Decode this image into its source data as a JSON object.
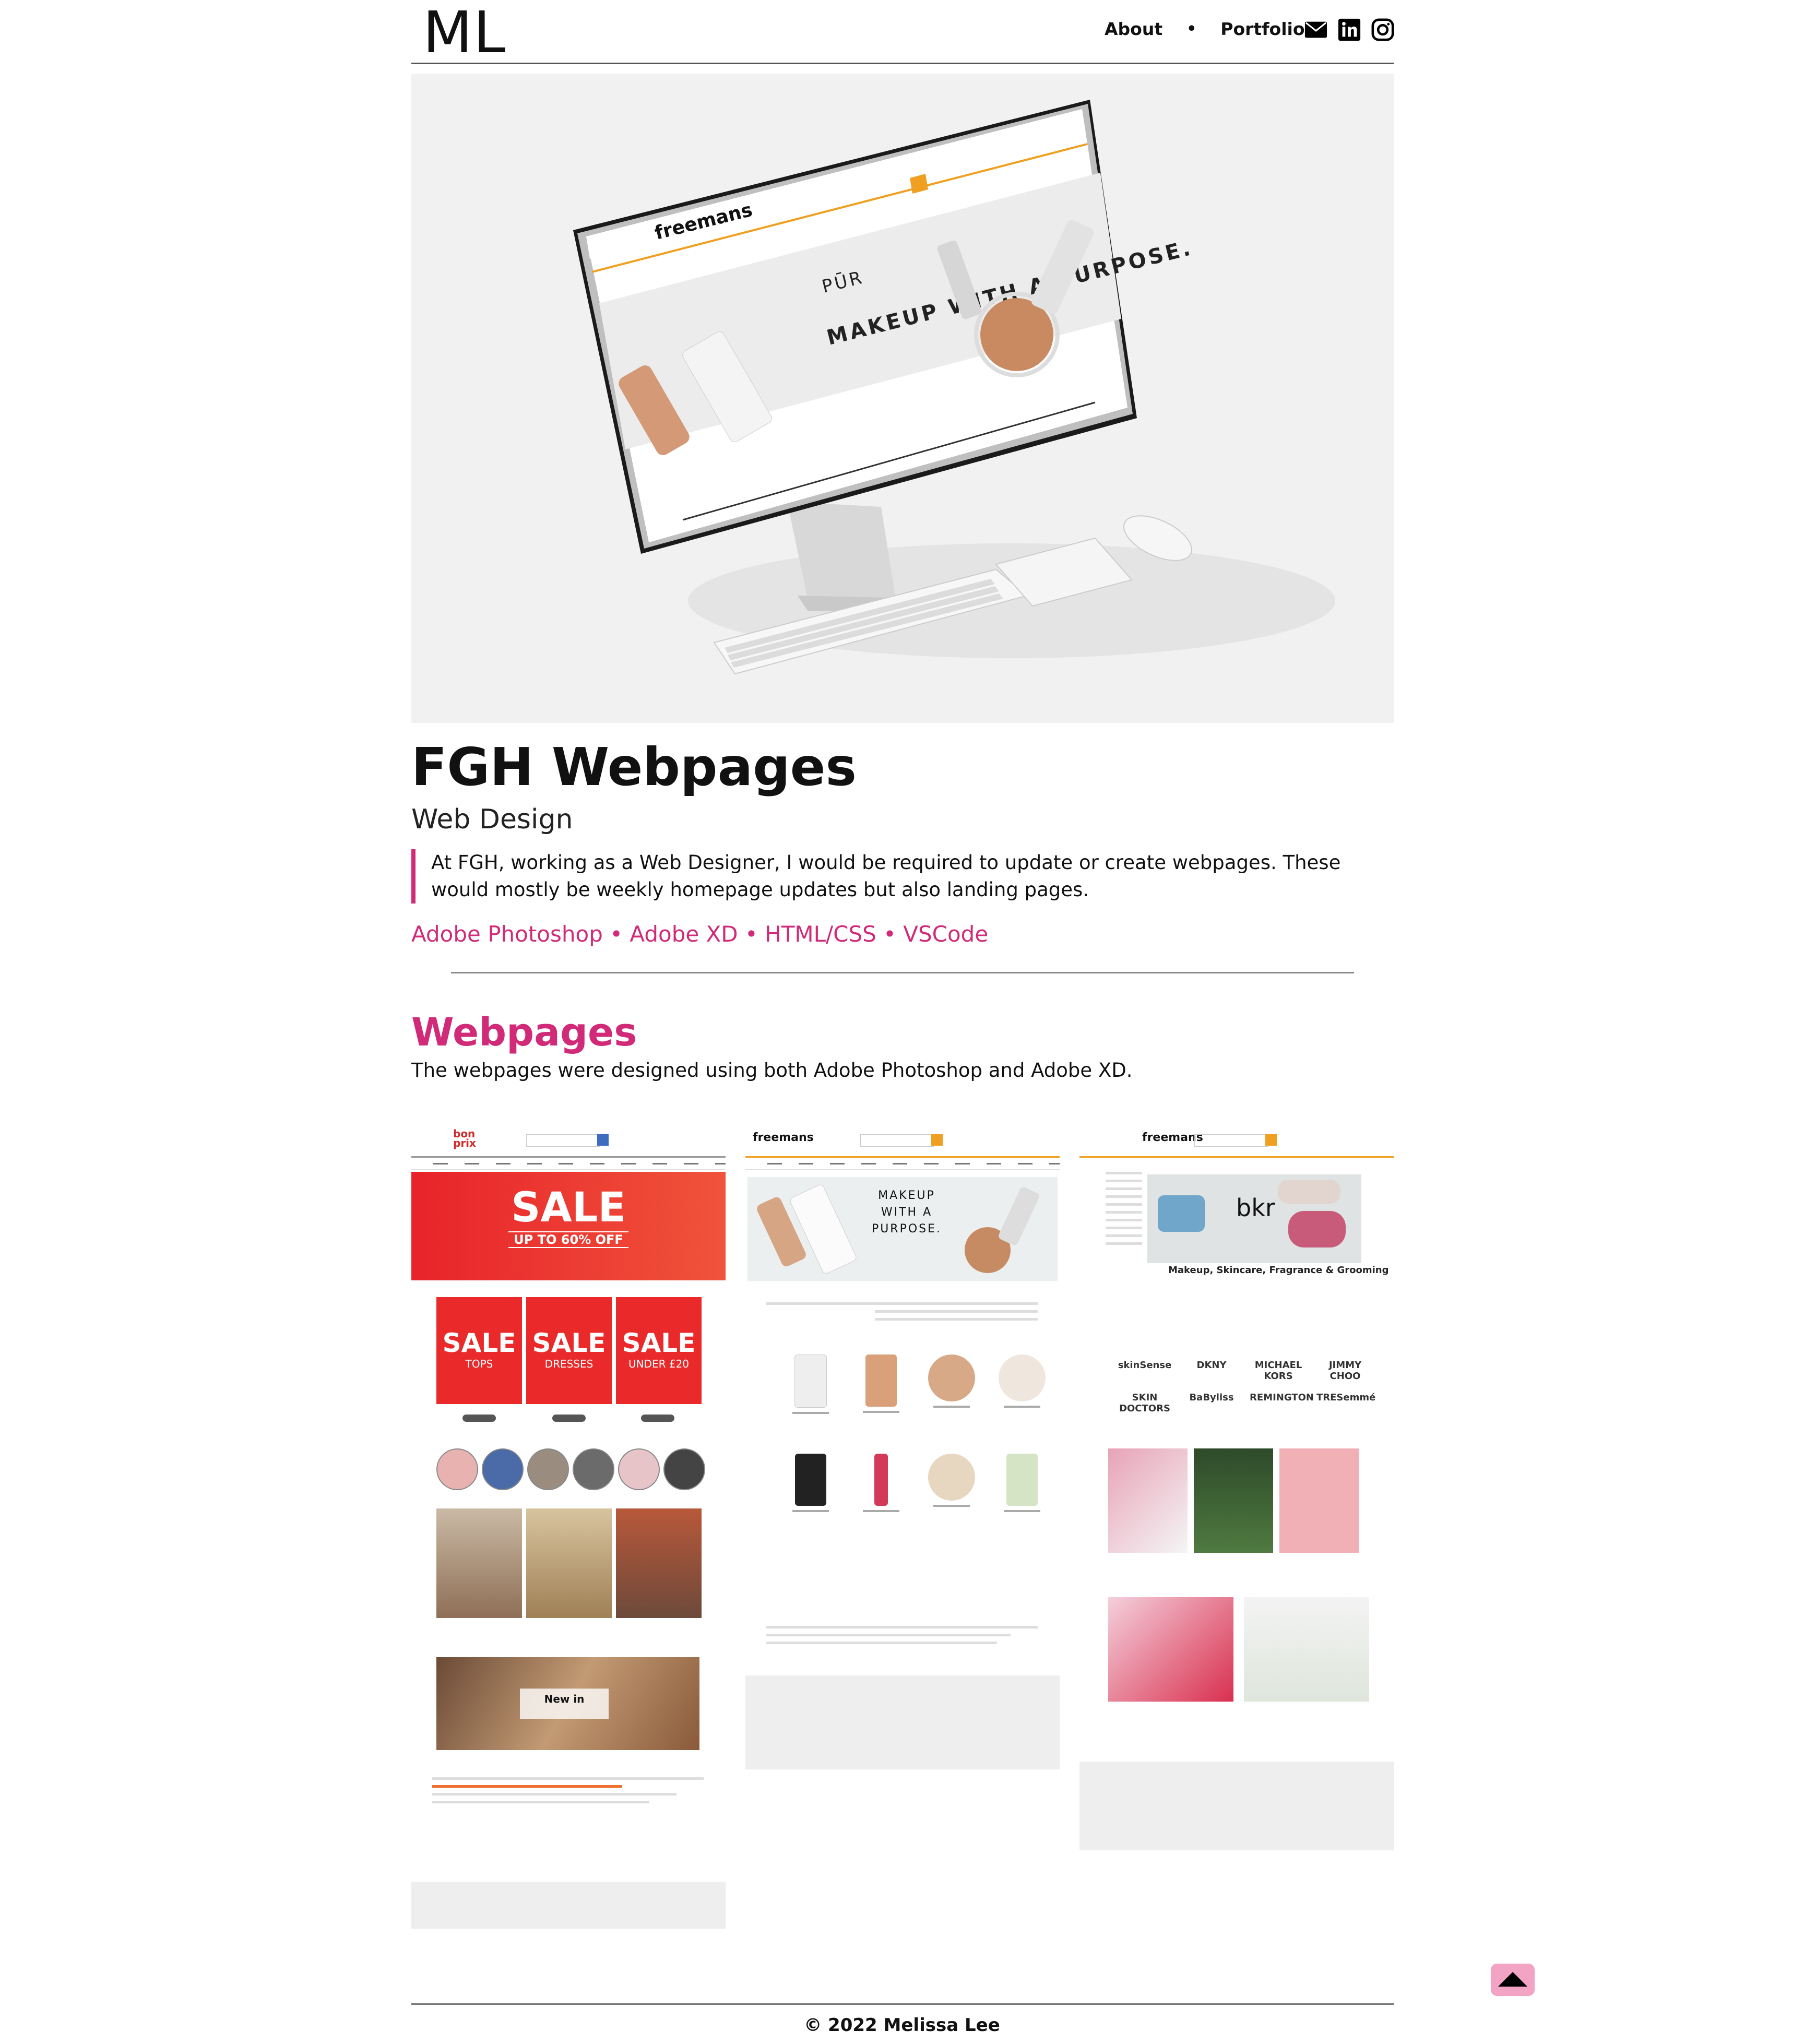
{
  "nav": {
    "logo": "ML",
    "links": [
      "About",
      "Portfolio"
    ],
    "separator": "•",
    "social_icons": [
      "envelope-icon",
      "linkedin-icon",
      "instagram-icon"
    ]
  },
  "hero": {
    "image": "imac-mockup-freemans-pur-makeup",
    "screen_brand": "freemans",
    "screen_headline": "MAKEUP WITH A PURPOSE.",
    "screen_brand2": "PŪR"
  },
  "project": {
    "title": "FGH Webpages",
    "subtitle": "Web Design",
    "description": "At FGH, working as a Web Designer, I would be required to update or create webpages. These would mostly be weekly homepage updates but also landing pages.",
    "tools": "Adobe Photoshop • Adobe XD • HTML/CSS  • VSCode"
  },
  "webpages": {
    "title": "Webpages",
    "description": "The webpages were designed using both Adobe Photoshop and Adobe XD.",
    "thumbs": [
      {
        "brand": "bon prix",
        "banner_title": "SALE",
        "banner_sub": "UP TO 60% OFF",
        "sale_tiles": [
          {
            "big": "SALE",
            "small": "TOPS"
          },
          {
            "big": "SALE",
            "small": "DRESSES"
          },
          {
            "big": "SALE",
            "small": "UNDER £20"
          }
        ],
        "feature": "New in"
      },
      {
        "brand": "freemans",
        "banner_text": "MAKEUP WITH A PURPOSE."
      },
      {
        "brand": "freemans",
        "banner_brand": "bkr",
        "heading": "Makeup, Skincare, Fragrance & Grooming",
        "brands": [
          "skinSense",
          "DKNY",
          "MICHAEL KORS",
          "JIMMY CHOO",
          "SKIN DOCTORS",
          "BaByliss",
          "REMINGTON",
          "TRESemmé"
        ]
      }
    ]
  },
  "colors": {
    "accent": "#d12a78",
    "sale_red": "#ea2a2a",
    "freemans_orange": "#f0a020",
    "top_button": "#f3a3c3"
  },
  "footer": {
    "copyright": "© 2022 Melissa Lee",
    "back_to_top_icon": "caret-up-icon"
  }
}
